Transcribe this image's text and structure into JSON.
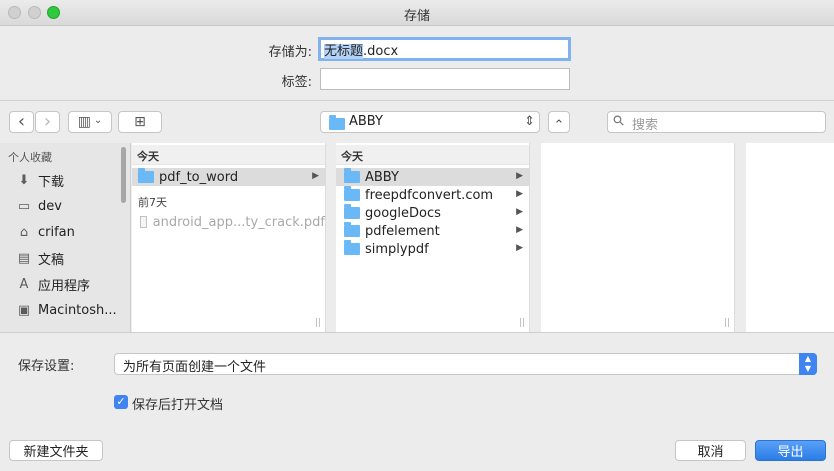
{
  "window": {
    "title": "存储"
  },
  "form": {
    "save_as_label": "存储为:",
    "filename_selected": "无标题",
    "filename_ext": ".docx",
    "tags_label": "标签:",
    "tags_value": ""
  },
  "toolbar": {
    "back_icon": "‹",
    "forward_icon": "›",
    "view_icon": "▥",
    "view_chevron": "⌄",
    "new_folder_icon": "⊞",
    "location": "ABBY",
    "location_stepper": "⇕",
    "expand_icon": "⌃",
    "search_placeholder": "搜索",
    "search_icon": "⚲"
  },
  "sidebar": {
    "header": "个人收藏",
    "items": [
      {
        "label": "下载",
        "icon": "⬇"
      },
      {
        "label": "dev",
        "icon": "▭"
      },
      {
        "label": "crifan",
        "icon": "⌂"
      },
      {
        "label": "文稿",
        "icon": "▤"
      },
      {
        "label": "应用程序",
        "icon": "A"
      },
      {
        "label": "Macintosh...",
        "icon": "▣"
      }
    ]
  },
  "column1": {
    "today_header": "今天",
    "today_items": [
      {
        "label": "pdf_to_word",
        "arrow": "▶"
      }
    ],
    "week_header": "前7天",
    "week_items": [
      {
        "label": "android_app...ty_crack.pdf"
      }
    ]
  },
  "column2": {
    "today_header": "今天",
    "items": [
      {
        "label": "ABBY",
        "arrow": "▶"
      },
      {
        "label": "freepdfconvert.com",
        "arrow": "▶"
      },
      {
        "label": "googleDocs",
        "arrow": "▶"
      },
      {
        "label": "pdfelement",
        "arrow": "▶"
      },
      {
        "label": "simplypdf",
        "arrow": "▶"
      }
    ]
  },
  "column_grip": "||",
  "bottom": {
    "save_settings_label": "保存设置:",
    "save_settings_value": "为所有页面创建一个文件",
    "stepper_up": "▲",
    "stepper_down": "▼",
    "open_after_save_label": "保存后打开文档",
    "checkmark": "✓",
    "new_folder_button": "新建文件夹",
    "cancel_button": "取消",
    "export_button": "导出"
  }
}
